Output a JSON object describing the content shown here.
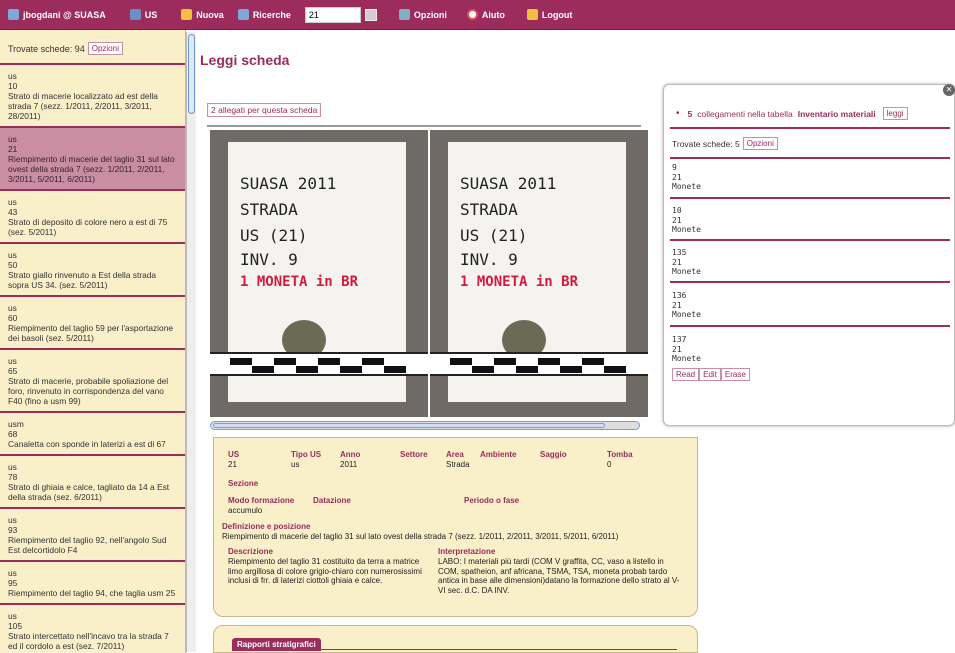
{
  "topbar": {
    "user": "jbogdani @ SUASA",
    "us": "US",
    "nuova": "Nuova",
    "ricerche": "Ricerche",
    "search_value": "21",
    "opzioni": "Opzioni",
    "aiuto": "Aiuto",
    "logout": "Logout"
  },
  "sidebar": {
    "found_label": "Trovate schede: 94",
    "options_button": "Opzioni",
    "items": [
      {
        "type": "us",
        "num": "10",
        "desc": "Strato di macerie localizzato ad est della strada 7 (sezz. 1/2011, 2/2011, 3/2011, 28/2011)"
      },
      {
        "type": "us",
        "num": "21",
        "desc": "Riempimento di macerie del taglio 31 sul lato ovest della strada 7 (sezz. 1/2011, 2/2011, 3/2011, 5/2011, 6/2011)"
      },
      {
        "type": "us",
        "num": "43",
        "desc": "Strato di deposito di colore nero a est di 75 (sez. 5/2011)"
      },
      {
        "type": "us",
        "num": "50",
        "desc": "Strato giallo rinvenuto a Est della strada sopra US 34. (sez. 5/2011)"
      },
      {
        "type": "us",
        "num": "60",
        "desc": "Riempimento del taglio 59 per l'asportazione dei basoli (sez. 5/2011)"
      },
      {
        "type": "us",
        "num": "65",
        "desc": "Strato di macerie, probabile spoliazione del foro, rinvenuto in corrispondenza del vano F40 (fino a usm 99)"
      },
      {
        "type": "usm",
        "num": "68",
        "desc": "Canaletta con sponde in laterizi a est di 67"
      },
      {
        "type": "us",
        "num": "78",
        "desc": "Strato di ghiaia e calce, tagliato da 14 a Est della strada (sez. 6/2011)"
      },
      {
        "type": "us",
        "num": "93",
        "desc": "Riempimento del taglio 92, nell'angolo Sud Est delcortidolo F4"
      },
      {
        "type": "us",
        "num": "95",
        "desc": "Riempimento del taglio 94, che taglia usm 25"
      },
      {
        "type": "us",
        "num": "105",
        "desc": "Strato intercettato nell'incavo tra la strada 7 ed il cordolo a est (sez. 7/2011)"
      }
    ]
  },
  "main": {
    "title": "Leggi scheda",
    "attachments_button": "2 allegati per questa scheda",
    "photo_text": {
      "l1": "SUASA 2011",
      "l2": "STRADA",
      "l3": "US (21)",
      "l4": "INV. 9",
      "l5": "1 MONETA in BR"
    }
  },
  "right_panel": {
    "links_count": "5",
    "links_text": "collegamenti nella tabella",
    "links_table": "Inventario materiali",
    "read_button": "leggi",
    "found_label": "Trovate schede: 5",
    "options_button": "Opzioni",
    "items": [
      {
        "id": "9",
        "us": "21",
        "name": "Monete"
      },
      {
        "id": "10",
        "us": "21",
        "name": "Monete"
      },
      {
        "id": "135",
        "us": "21",
        "name": "Monete"
      },
      {
        "id": "136",
        "us": "21",
        "name": "Monete"
      },
      {
        "id": "137",
        "us": "21",
        "name": "Monete"
      }
    ],
    "actions": {
      "read": "Read",
      "edit": "Edit",
      "erase": "Erase"
    }
  },
  "detail": {
    "labels": {
      "us": "US",
      "tipo_us": "Tipo US",
      "anno": "Anno",
      "settore": "Settore",
      "area": "Area",
      "ambiente": "Ambiente",
      "saggio": "Saggio",
      "tomba": "Tomba",
      "sezione": "Sezione",
      "modo": "Modo formazione",
      "datazione": "Datazione",
      "periodo": "Periodo o fase",
      "definizione": "Definizione e posizione",
      "descrizione": "Descrizione",
      "interpretazione": "Interpretazione"
    },
    "values": {
      "us": "21",
      "tipo_us": "us",
      "anno": "2011",
      "area": "Strada",
      "tomba": "0",
      "modo": "accumulo",
      "definizione": "Riempimento di macerie del taglio 31 sul lato ovest della strada 7 (sezz. 1/2011, 2/2011, 3/2011, 5/2011, 6/2011)",
      "descrizione": "Riempimento del taglio 31 costituito da terra a matrice limo argillosa di colore grigio-chiaro con numerosissimi inclusi di frr. di laterizi ciottoli ghiaia e calce.",
      "interpretazione": "LABO: I materiali più tardi (COM V graffita, CC, vaso a listello in COM, spatheion, anf africana, TSMA, TSA, moneta probab tardo antica in base alle dimensioni)datano la formazione dello strato al V-VI sec. d.C. DA INV."
    }
  },
  "rapporti": {
    "tab": "Rapporti stratigrafici"
  }
}
